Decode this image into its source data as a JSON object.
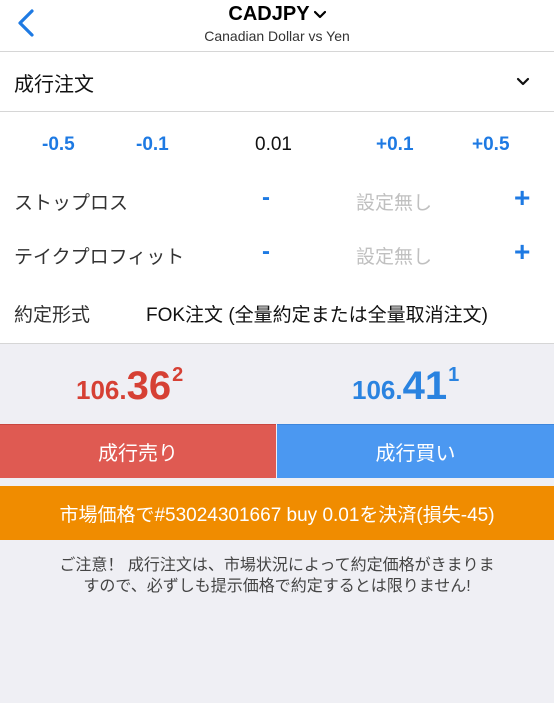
{
  "header": {
    "symbol": "CADJPY",
    "subtitle": "Canadian Dollar vs Yen",
    "back_icon": "chevron-left-icon",
    "symbol_dropdown_icon": "chevron-down-icon"
  },
  "order_type": {
    "value": "成行注文",
    "dropdown_icon": "chevron-down-icon"
  },
  "volume": {
    "dec_large": "-0.5",
    "dec_small": "-0.1",
    "value": "0.01",
    "inc_small": "+0.1",
    "inc_large": "+0.5"
  },
  "stop_loss": {
    "label": "ストップロス",
    "minus": "-",
    "placeholder": "設定無し",
    "plus": "+"
  },
  "take_profit": {
    "label": "テイクプロフィット",
    "minus": "-",
    "placeholder": "設定無し",
    "plus": "+"
  },
  "fill_policy": {
    "label": "約定形式",
    "value": "FOK注文 (全量約定または全量取消注文)"
  },
  "prices": {
    "sell": {
      "prefix": "106.",
      "big": "36",
      "sup": "2"
    },
    "buy": {
      "prefix": "106.",
      "big": "41",
      "sup": "1"
    }
  },
  "buttons": {
    "sell": "成行売り",
    "buy": "成行買い",
    "close_position": "市場価格で#53024301667 buy 0.01を決済(損失-45)"
  },
  "notice": {
    "line1": "ご注意！ 成行注文は、市場状況によって約定価格がきまりま",
    "line2": "すので、必ずしも提示価格で約定するとは限りません!"
  },
  "colors": {
    "accent_blue": "#1e7ae3",
    "sell_red": "#d64034",
    "buy_blue": "#2a83e0",
    "sell_button": "#df5a52",
    "buy_button": "#4b98f1",
    "close_button": "#f08c00"
  }
}
